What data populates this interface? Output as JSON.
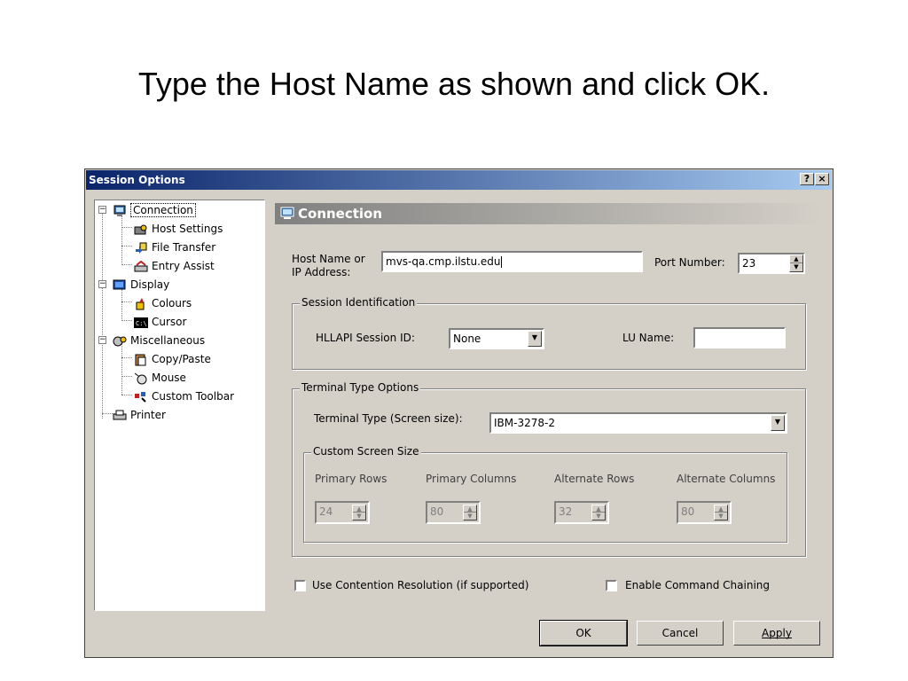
{
  "slide": {
    "title": "Type the Host Name as shown and click OK."
  },
  "dialog": {
    "title": "Session Options",
    "help_label": "?",
    "close_label": "×"
  },
  "tree": [
    {
      "label": "Connection",
      "icon": "connection-icon",
      "level": 0,
      "expander": "−"
    },
    {
      "label": "Host Settings",
      "icon": "host-settings-icon",
      "level": 1
    },
    {
      "label": "File Transfer",
      "icon": "file-transfer-icon",
      "level": 1
    },
    {
      "label": "Entry Assist",
      "icon": "entry-assist-icon",
      "level": 1
    },
    {
      "label": "Display",
      "icon": "display-icon",
      "level": 0,
      "expander": "−"
    },
    {
      "label": "Colours",
      "icon": "colours-icon",
      "level": 1
    },
    {
      "label": "Cursor",
      "icon": "cursor-icon",
      "level": 1
    },
    {
      "label": "Miscellaneous",
      "icon": "miscellaneous-icon",
      "level": 0,
      "expander": "−"
    },
    {
      "label": "Copy/Paste",
      "icon": "copy-paste-icon",
      "level": 1
    },
    {
      "label": "Mouse",
      "icon": "mouse-icon",
      "level": 1
    },
    {
      "label": "Custom Toolbar",
      "icon": "custom-toolbar-icon",
      "level": 1
    },
    {
      "label": "Printer",
      "icon": "printer-icon",
      "level": 0
    }
  ],
  "panel": {
    "header": "Connection",
    "host_label_1": "Host Name or",
    "host_label_2": "IP Address:",
    "host_value": "mvs-qa.cmp.ilstu.edu",
    "port_label": "Port Number:",
    "port_value": "23",
    "session_group": "Session Identification",
    "hllapi_label": "HLLAPI Session ID:",
    "hllapi_value": "None",
    "lu_label": "LU Name:",
    "lu_value": "",
    "terminal_group": "Terminal Type Options",
    "terminal_label": "Terminal Type (Screen size):",
    "terminal_value": "IBM-3278-2",
    "custom_group": "Custom Screen Size",
    "primary_rows_label": "Primary Rows",
    "primary_rows_value": "24",
    "primary_cols_label": "Primary Columns",
    "primary_cols_value": "80",
    "alt_rows_label": "Alternate Rows",
    "alt_rows_value": "32",
    "alt_cols_label": "Alternate Columns",
    "alt_cols_value": "80",
    "contention_label": "Use Contention Resolution (if supported)",
    "chaining_label": "Enable Command Chaining"
  },
  "buttons": {
    "ok": "OK",
    "cancel": "Cancel",
    "apply": "Apply"
  },
  "colors": {
    "title_start": "#0a246a",
    "title_end": "#a6caf0",
    "face": "#d4d0c8"
  }
}
